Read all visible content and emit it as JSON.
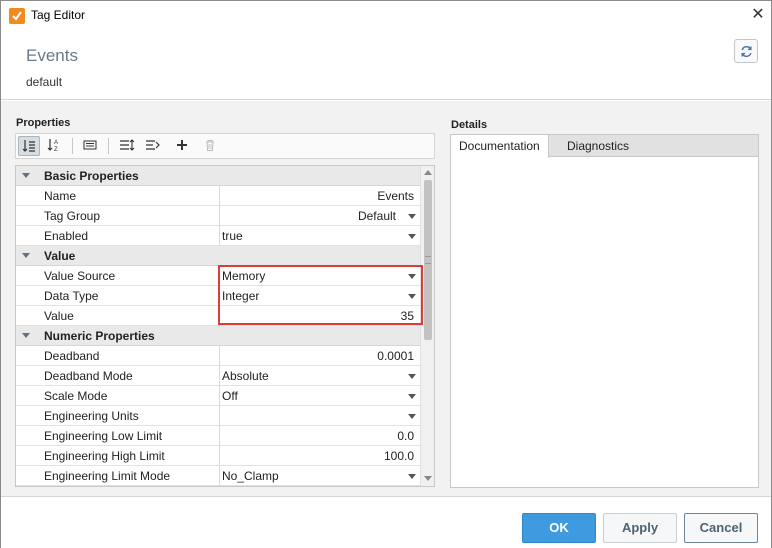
{
  "window": {
    "title": "Tag Editor",
    "close_glyph": "✕"
  },
  "header": {
    "tag_name": "Events",
    "provider": "default"
  },
  "properties": {
    "label": "Properties",
    "categories": [
      {
        "name": "Basic Properties",
        "rows": [
          {
            "name": "Name",
            "value": "Events",
            "align": "right",
            "dropdown": false
          },
          {
            "name": "Tag Group",
            "value": "Default",
            "align": "right",
            "dropdown": true
          },
          {
            "name": "Enabled",
            "value": "true",
            "align": "left",
            "dropdown": true
          }
        ]
      },
      {
        "name": "Value",
        "rows": [
          {
            "name": "Value Source",
            "value": "Memory",
            "align": "left",
            "dropdown": true
          },
          {
            "name": "Data Type",
            "value": "Integer",
            "align": "left",
            "dropdown": true
          },
          {
            "name": "Value",
            "value": "35",
            "align": "right",
            "dropdown": false
          }
        ]
      },
      {
        "name": "Numeric Properties",
        "rows": [
          {
            "name": "Deadband",
            "value": "0.0001",
            "align": "right",
            "dropdown": false
          },
          {
            "name": "Deadband Mode",
            "value": "Absolute",
            "align": "left",
            "dropdown": true
          },
          {
            "name": "Scale Mode",
            "value": "Off",
            "align": "left",
            "dropdown": true
          },
          {
            "name": "Engineering Units",
            "value": "",
            "align": "left",
            "dropdown": true
          },
          {
            "name": "Engineering Low Limit",
            "value": "0.0",
            "align": "right",
            "dropdown": false
          },
          {
            "name": "Engineering High Limit",
            "value": "100.0",
            "align": "right",
            "dropdown": false
          },
          {
            "name": "Engineering Limit Mode",
            "value": "No_Clamp",
            "align": "left",
            "dropdown": true
          }
        ]
      }
    ]
  },
  "toolbar": {
    "icons": [
      "sort-categorized-icon",
      "sort-alphabetical-icon",
      "property-pages-icon",
      "expand-all-icon",
      "collapse-all-icon",
      "add-icon",
      "delete-icon"
    ]
  },
  "details": {
    "label": "Details",
    "tabs": [
      {
        "label": "Documentation",
        "active": true
      },
      {
        "label": "Diagnostics",
        "active": false
      }
    ]
  },
  "footer": {
    "ok": "OK",
    "apply": "Apply",
    "cancel": "Cancel"
  },
  "colors": {
    "accent": "#3f9ae0",
    "highlight": "#e03a3a",
    "app_icon": "#f28a1e"
  }
}
